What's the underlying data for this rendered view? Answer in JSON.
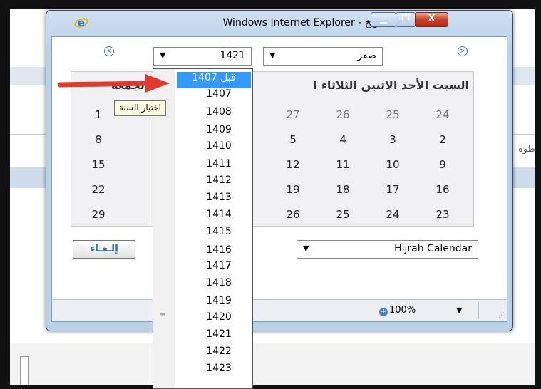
{
  "window": {
    "title": "انتقاء تاريخ - Windows Internet Explorer",
    "minimize_glyph": "▁",
    "maximize_glyph": "☐",
    "close_glyph": "X"
  },
  "background": {
    "partial_text": "طوة"
  },
  "calendar": {
    "year_selected": "1421",
    "month_selected": "صفر",
    "days_of_week_right": "السبت الأحد الاثنين الثلاثاء ا",
    "days_of_week_left": "س الجمعة",
    "rows_right": [
      [
        "27",
        "26",
        "25",
        "24"
      ],
      [
        "5",
        "4",
        "3",
        "2"
      ],
      [
        "12",
        "11",
        "10",
        "9"
      ],
      [
        "19",
        "18",
        "17",
        "16"
      ],
      [
        "26",
        "25",
        "24",
        "23"
      ]
    ],
    "rows_left": [
      "1",
      "8",
      "15",
      "22",
      "29"
    ],
    "cancel_label": "إلـغـاء",
    "calendar_type": "Hijrah Calendar"
  },
  "dropdown": {
    "selected_item": "قبل 1407",
    "items": [
      "1407",
      "1408",
      "1409",
      "1410",
      "1411",
      "1412",
      "1413",
      "1414",
      "1415",
      "1416",
      "1417",
      "1418",
      "1419",
      "1420",
      "1421",
      "1422",
      "1423"
    ],
    "tooltip": "اختيار السنة"
  },
  "status": {
    "zoom": "100%"
  },
  "colors": {
    "selection": "#3399ff",
    "arrow": "#e03a2c",
    "window_frame": "#b9d1ea"
  }
}
